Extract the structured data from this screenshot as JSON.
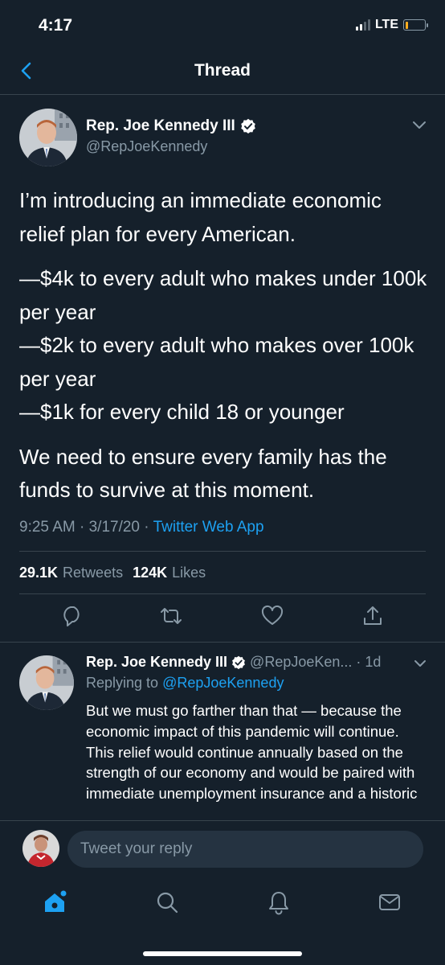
{
  "status_bar": {
    "time": "4:17",
    "network": "LTE",
    "signal_bars": 2
  },
  "header": {
    "title": "Thread",
    "back_icon": "chevron-left-icon"
  },
  "main_tweet": {
    "author_name": "Rep. Joe Kennedy III",
    "handle": "@RepJoeKennedy",
    "verified": true,
    "paragraphs": [
      "I’m introducing an immediate economic relief plan for every American.",
      "—$4k to every adult who makes under 100k per year",
      "—$2k to every adult who makes over 100k per year",
      "—$1k for every child 18 or younger",
      "We need to ensure every family has the funds to survive at this moment."
    ],
    "time": "9:25 AM",
    "date": "3/17/20",
    "separator": "·",
    "source": "Twitter Web App",
    "retweets_count": "29.1K",
    "retweets_label": "Retweets",
    "likes_count": "124K",
    "likes_label": "Likes"
  },
  "reply_tweet": {
    "author_name": "Rep. Joe Kennedy III",
    "handle": "@RepJoeKen...",
    "age": "· 1d",
    "replying_prefix": "Replying to",
    "replying_to": "@RepJoeKennedy",
    "text": "But we must go farther than that — because the economic impact of this pandemic will continue. This relief would continue annually based on the strength of our economy and would be paired with immediate unemployment insurance and a historic"
  },
  "reply_box": {
    "placeholder": "Tweet your reply"
  },
  "tab_bar": {
    "items": [
      "home-icon",
      "search-icon",
      "notifications-icon",
      "messages-icon"
    ],
    "active": "home-icon"
  },
  "colors": {
    "background": "#15202b",
    "accent": "#1da1f2",
    "secondary_text": "#8899a6",
    "divider": "#38444d"
  }
}
